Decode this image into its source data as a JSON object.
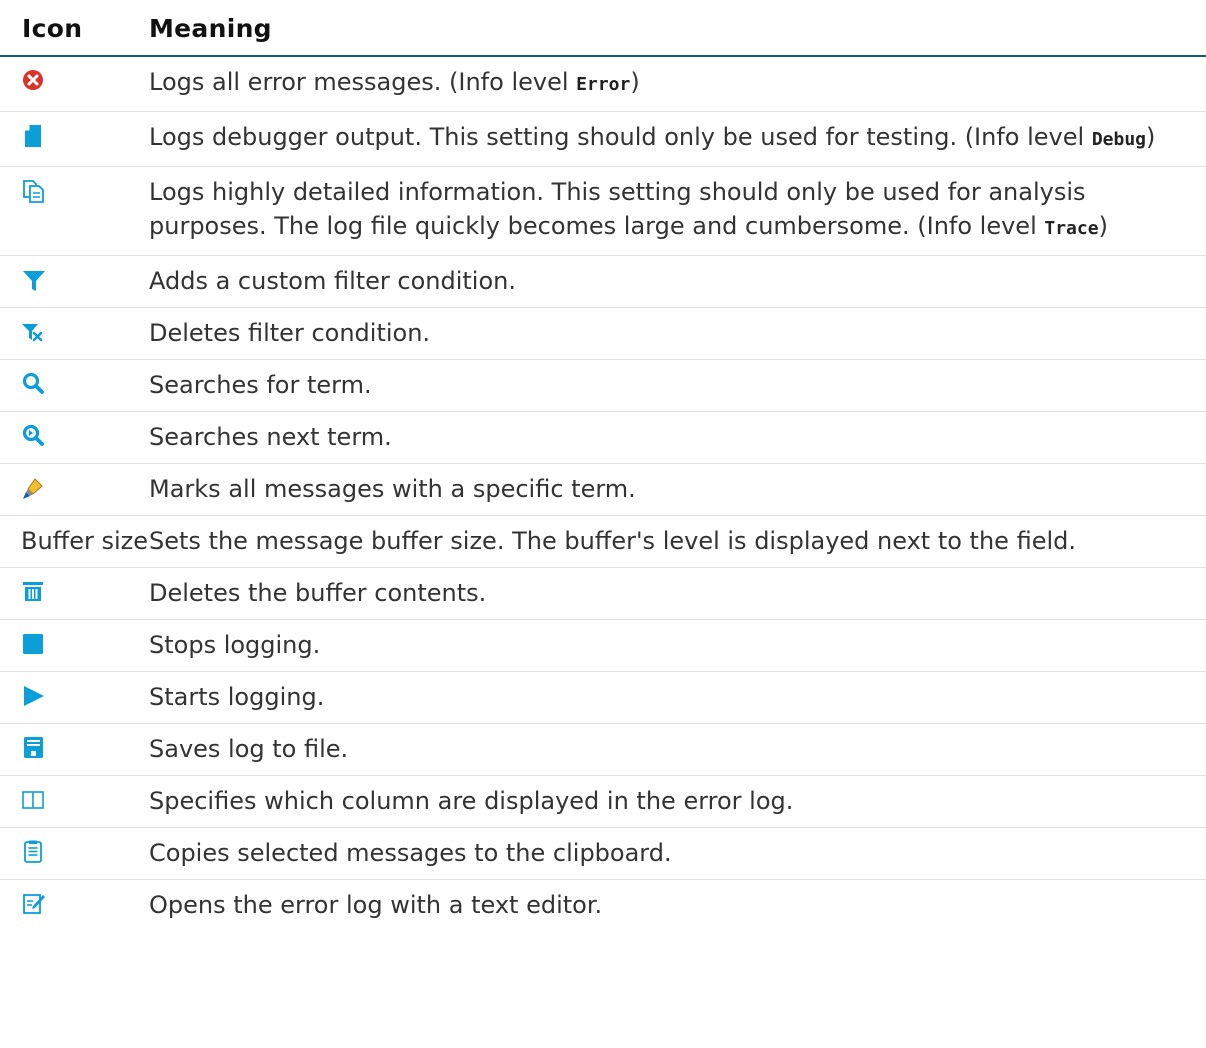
{
  "table": {
    "header_icon": "Icon",
    "header_meaning": "Meaning",
    "rows": [
      {
        "icon": "error-icon",
        "pre": "Logs all error messages. (Info level ",
        "code": "Error",
        "post": ")"
      },
      {
        "icon": "debug-document-icon",
        "pre": "Logs debugger output. This setting should only be used for testing. (Info level ",
        "code": "Debug",
        "post": ")"
      },
      {
        "icon": "trace-documents-icon",
        "pre": "Logs highly detailed information. This setting should only be used for analysis purposes. The log file quickly becomes large and cumbersome. (Info level ",
        "code": "Trace",
        "post": ")"
      },
      {
        "icon": "filter-icon",
        "text": "Adds a custom filter condition."
      },
      {
        "icon": "filter-delete-icon",
        "text": "Deletes filter condition."
      },
      {
        "icon": "search-icon",
        "text": "Searches for term."
      },
      {
        "icon": "search-next-icon",
        "text": "Searches next term."
      },
      {
        "icon": "highlighter-icon",
        "text": "Marks all messages with a specific term."
      },
      {
        "label": "Buffer size",
        "text": "Sets the message buffer size. The buffer's level is displayed next to the field."
      },
      {
        "icon": "trash-icon",
        "text": "Deletes the buffer contents."
      },
      {
        "icon": "stop-icon",
        "text": "Stops logging."
      },
      {
        "icon": "play-icon",
        "text": "Starts logging."
      },
      {
        "icon": "save-icon",
        "text": "Saves log to file."
      },
      {
        "icon": "columns-icon",
        "text": "Specifies which column are displayed in the error log."
      },
      {
        "icon": "clipboard-icon",
        "text": "Copies selected messages to the clipboard."
      },
      {
        "icon": "text-editor-icon",
        "text": "Opens the error log with a text editor."
      }
    ]
  },
  "colors": {
    "icon_blue": "#0b9ed9",
    "error_red": "#d9342b",
    "header_rule": "#1c5a73",
    "row_rule": "#e2e2e2",
    "highlighter_yellow": "#f2c02e"
  }
}
